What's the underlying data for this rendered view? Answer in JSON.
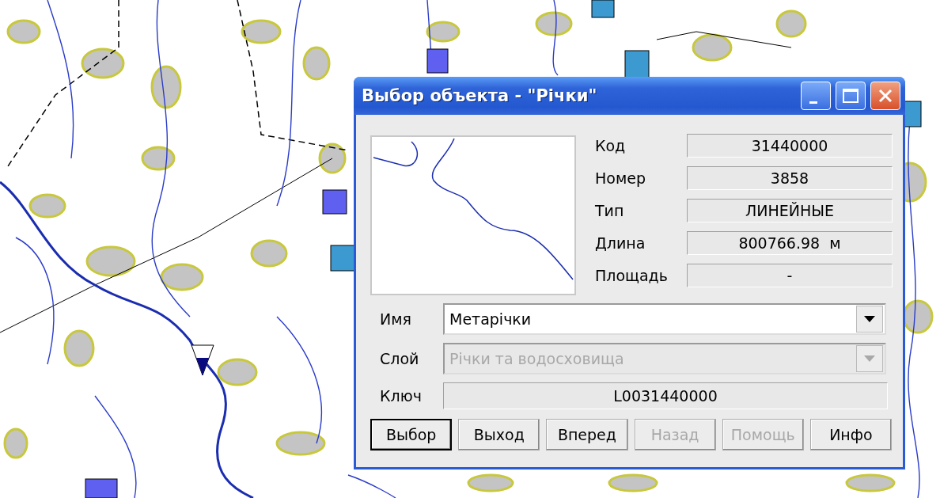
{
  "window": {
    "title": "Выбор объекта - \"Річки\""
  },
  "fields": [
    {
      "label": "Код",
      "value": "31440000"
    },
    {
      "label": "Номер",
      "value": "3858"
    },
    {
      "label": "Тип",
      "value": "ЛИНЕЙНЫЕ"
    },
    {
      "label": "Длина",
      "value": "800766.98  м"
    },
    {
      "label": "Площадь",
      "value": "-"
    }
  ],
  "combos": [
    {
      "label": "Имя",
      "value": "Метарічки",
      "disabled": false
    },
    {
      "label": "Слой",
      "value": "Річки та водосховища",
      "disabled": true
    }
  ],
  "key": {
    "label": "Ключ",
    "value": "L0031440000"
  },
  "buttons": [
    {
      "label": "Выбор",
      "disabled": false,
      "default": true
    },
    {
      "label": "Выход",
      "disabled": false,
      "default": false
    },
    {
      "label": "Вперед",
      "disabled": false,
      "default": false
    },
    {
      "label": "Назад",
      "disabled": true,
      "default": false
    },
    {
      "label": "Помощь",
      "disabled": true,
      "default": false
    },
    {
      "label": "Инфо",
      "disabled": false,
      "default": false
    }
  ]
}
